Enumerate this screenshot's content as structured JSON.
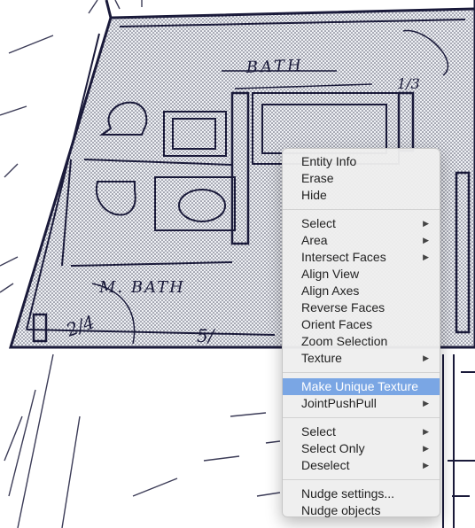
{
  "context_menu": {
    "groups": [
      [
        {
          "label": "Entity Info",
          "submenu": false
        },
        {
          "label": "Erase",
          "submenu": false
        },
        {
          "label": "Hide",
          "submenu": false
        }
      ],
      [
        {
          "label": "Select",
          "submenu": true
        },
        {
          "label": "Area",
          "submenu": true
        },
        {
          "label": "Intersect Faces",
          "submenu": true
        },
        {
          "label": "Align View",
          "submenu": false
        },
        {
          "label": "Align Axes",
          "submenu": false
        },
        {
          "label": "Reverse Faces",
          "submenu": false
        },
        {
          "label": "Orient Faces",
          "submenu": false
        },
        {
          "label": "Zoom Selection",
          "submenu": false
        },
        {
          "label": "Texture",
          "submenu": true
        }
      ],
      [
        {
          "label": "Make Unique Texture",
          "submenu": false,
          "highlighted": true
        },
        {
          "label": "JointPushPull",
          "submenu": true
        }
      ],
      [
        {
          "label": "Select",
          "submenu": true
        },
        {
          "label": "Select Only",
          "submenu": true
        },
        {
          "label": "Deselect",
          "submenu": true
        }
      ],
      [
        {
          "label": "Nudge settings...",
          "submenu": false
        },
        {
          "label": "Nudge objects",
          "submenu": false
        }
      ]
    ],
    "submenu_arrow": "▶",
    "highlight_color": "#7aa6e4"
  },
  "drawing": {
    "labels": {
      "bath": "BATH",
      "m_bath": "M. BATH",
      "dim_1": "2/4",
      "dim_2": "5/",
      "dim_3": "1/3"
    },
    "colors": {
      "ink": "#1a1a3a",
      "dot_fill": "#cfd1d8"
    }
  }
}
